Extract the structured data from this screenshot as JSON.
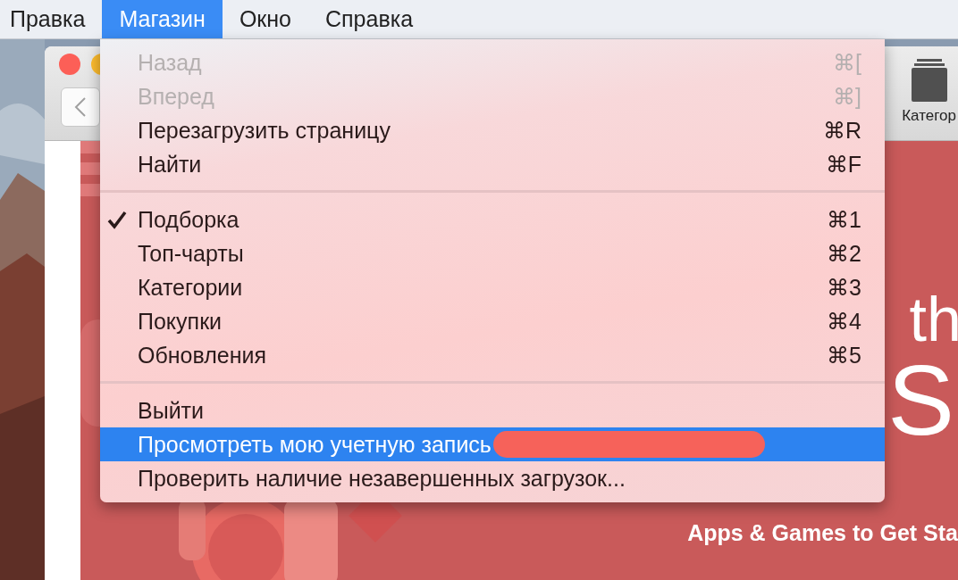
{
  "menu_bar": {
    "items": [
      {
        "label": "Правка",
        "selected": false
      },
      {
        "label": "Магазин",
        "selected": true
      },
      {
        "label": "Окно",
        "selected": false
      },
      {
        "label": "Справка",
        "selected": false
      }
    ]
  },
  "window": {
    "toolbar": {
      "categories_label": "Категор"
    },
    "banner": {
      "headline_1": "th",
      "headline_2": "S",
      "caption": "Apps & Games to Get Sta"
    }
  },
  "menu": {
    "sections": [
      {
        "items": [
          {
            "label": "Назад",
            "shortcut": "⌘[",
            "disabled": true,
            "checked": false,
            "selected": false,
            "redacted": false
          },
          {
            "label": "Вперед",
            "shortcut": "⌘]",
            "disabled": true,
            "checked": false,
            "selected": false,
            "redacted": false
          },
          {
            "label": "Перезагрузить страницу",
            "shortcut": "⌘R",
            "disabled": false,
            "checked": false,
            "selected": false,
            "redacted": false
          },
          {
            "label": "Найти",
            "shortcut": "⌘F",
            "disabled": false,
            "checked": false,
            "selected": false,
            "redacted": false
          }
        ]
      },
      {
        "items": [
          {
            "label": "Подборка",
            "shortcut": "⌘1",
            "disabled": false,
            "checked": true,
            "selected": false,
            "redacted": false
          },
          {
            "label": "Топ-чарты",
            "shortcut": "⌘2",
            "disabled": false,
            "checked": false,
            "selected": false,
            "redacted": false
          },
          {
            "label": "Категории",
            "shortcut": "⌘3",
            "disabled": false,
            "checked": false,
            "selected": false,
            "redacted": false
          },
          {
            "label": "Покупки",
            "shortcut": "⌘4",
            "disabled": false,
            "checked": false,
            "selected": false,
            "redacted": false
          },
          {
            "label": "Обновления",
            "shortcut": "⌘5",
            "disabled": false,
            "checked": false,
            "selected": false,
            "redacted": false
          }
        ]
      },
      {
        "items": [
          {
            "label": "Выйти",
            "disabled": false,
            "checked": false,
            "selected": false,
            "redacted": false
          },
          {
            "label": "Просмотреть мою учетную запись",
            "disabled": false,
            "checked": false,
            "selected": true,
            "redacted": true
          },
          {
            "label": "Проверить наличие незавершенных загрузок...",
            "disabled": false,
            "checked": false,
            "selected": false,
            "redacted": false
          }
        ]
      }
    ]
  }
}
